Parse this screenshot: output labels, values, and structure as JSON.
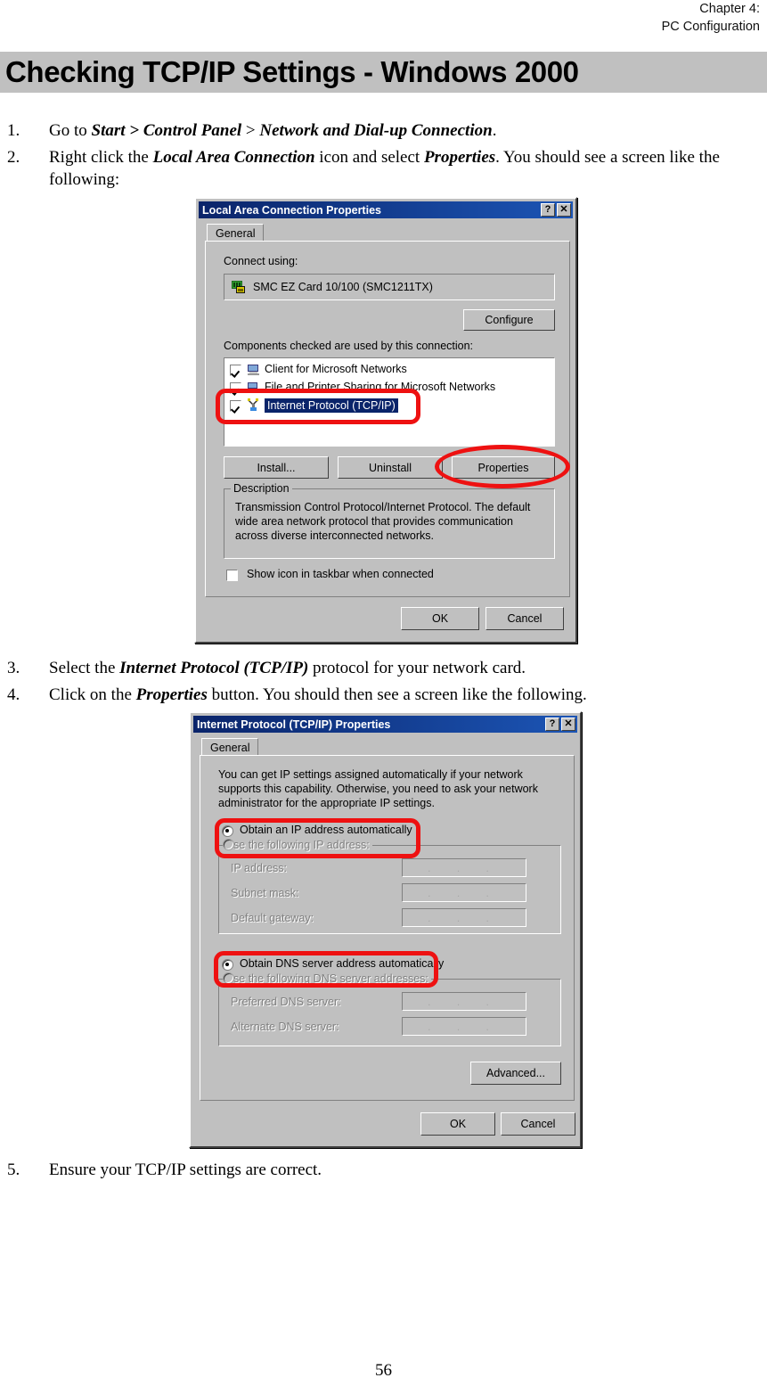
{
  "header": {
    "line1": "Chapter 4:",
    "line2": "PC Configuration"
  },
  "title": "Checking TCP/IP Settings - Windows 2000",
  "page_number": "56",
  "steps": [
    {
      "num": "1.",
      "parts": [
        {
          "t": "Go to ",
          "b": false
        },
        {
          "t": "Start > Control Panel",
          "b": true
        },
        {
          "t": " > ",
          "b": false
        },
        {
          "t": "Network and Dial-up Connection",
          "b": true
        },
        {
          "t": ".",
          "b": false
        }
      ]
    },
    {
      "num": "2.",
      "parts": [
        {
          "t": "Right click the ",
          "b": false
        },
        {
          "t": "Local Area Connection",
          "b": true
        },
        {
          "t": " icon and select ",
          "b": false
        },
        {
          "t": "Properties",
          "b": true
        },
        {
          "t": ". You should see a screen like the following:",
          "b": false
        }
      ]
    },
    {
      "num": "3.",
      "parts": [
        {
          "t": "Select the ",
          "b": false
        },
        {
          "t": "Internet Protocol (TCP/IP)",
          "b": true
        },
        {
          "t": " protocol for your network card.",
          "b": false
        }
      ]
    },
    {
      "num": "4.",
      "parts": [
        {
          "t": "Click on the ",
          "b": false
        },
        {
          "t": "Properties",
          "b": true
        },
        {
          "t": " button. You should then see a screen like the following.",
          "b": false
        }
      ]
    },
    {
      "num": "5.",
      "parts": [
        {
          "t": "Ensure your TCP/IP settings are correct.",
          "b": false
        }
      ]
    }
  ],
  "dialog1": {
    "title": "Local Area Connection Properties",
    "help_button": "?",
    "close_button": "✕",
    "tab": "General",
    "connect_using_label": "Connect using:",
    "adapter_name": "SMC EZ Card 10/100 (SMC1211TX)",
    "adapter_icon": "network-adapter-icon",
    "configure_button": "Configure",
    "components_label": "Components checked are used by this connection:",
    "components": [
      {
        "label": "Client for Microsoft Networks",
        "checked": true,
        "selected": false,
        "icon": "computer-icon"
      },
      {
        "label": "File and Printer Sharing for Microsoft Networks",
        "checked": true,
        "selected": false,
        "icon": "file-printer-icon"
      },
      {
        "label": "Internet Protocol (TCP/IP)",
        "checked": true,
        "selected": true,
        "icon": "protocol-icon"
      }
    ],
    "install_button": "Install...",
    "uninstall_button": "Uninstall",
    "properties_button": "Properties",
    "description_group": "Description",
    "description_text": "Transmission Control Protocol/Internet Protocol. The default wide area network protocol that provides communication across diverse interconnected networks.",
    "show_icon_checkbox": "Show icon in taskbar when connected",
    "show_icon_checked": false,
    "ok_button": "OK",
    "cancel_button": "Cancel"
  },
  "dialog2": {
    "title": "Internet Protocol (TCP/IP) Properties",
    "help_button": "?",
    "close_button": "✕",
    "tab": "General",
    "intro_text": "You can get IP settings assigned automatically if your network supports this capability. Otherwise, you need to ask your network administrator for the appropriate IP settings.",
    "radio_auto_ip": "Obtain an IP address automatically",
    "radio_auto_ip_selected": true,
    "radio_manual_ip": "Use the following IP address:",
    "field_ip_address": "IP address:",
    "field_subnet_mask": "Subnet mask:",
    "field_default_gateway": "Default gateway:",
    "ip_value": ".  .  .",
    "radio_auto_dns": "Obtain DNS server address automatically",
    "radio_auto_dns_selected": true,
    "radio_manual_dns": "Use the following DNS server addresses:",
    "field_preferred_dns": "Preferred DNS server:",
    "field_alternate_dns": "Alternate DNS server:",
    "advanced_button": "Advanced...",
    "ok_button": "OK",
    "cancel_button": "Cancel"
  },
  "annotations": {
    "color": "#ee1111",
    "items": [
      {
        "name": "highlight-tcpip-item",
        "shape": "rounded-rect"
      },
      {
        "name": "highlight-properties-button",
        "shape": "ellipse"
      },
      {
        "name": "highlight-obtain-ip-automatically",
        "shape": "rounded-rect"
      },
      {
        "name": "highlight-obtain-dns-automatically",
        "shape": "rounded-rect"
      }
    ]
  }
}
